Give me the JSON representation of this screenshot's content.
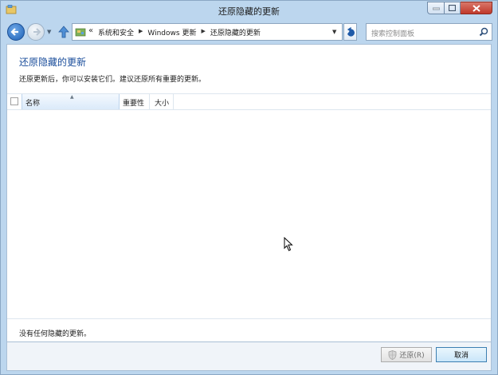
{
  "window": {
    "title": "还原隐藏的更新"
  },
  "address_bar": {
    "overflow_chevron": "«",
    "crumbs": [
      "系统和安全",
      "Windows 更新",
      "还原隐藏的更新"
    ]
  },
  "search": {
    "placeholder": "搜索控制面板"
  },
  "main": {
    "heading": "还原隐藏的更新",
    "subtext": "还原更新后，你可以安装它们。建议还原所有重要的更新。",
    "columns": {
      "name": "名称",
      "importance": "重要性",
      "size": "大小"
    },
    "status": "没有任何隐藏的更新。"
  },
  "footer": {
    "restore_label": "还原(R)",
    "cancel_label": "取消"
  },
  "colors": {
    "title_blue": "#1a4d9b",
    "frame": "#bcd6ee",
    "close_red": "#c0392b"
  }
}
